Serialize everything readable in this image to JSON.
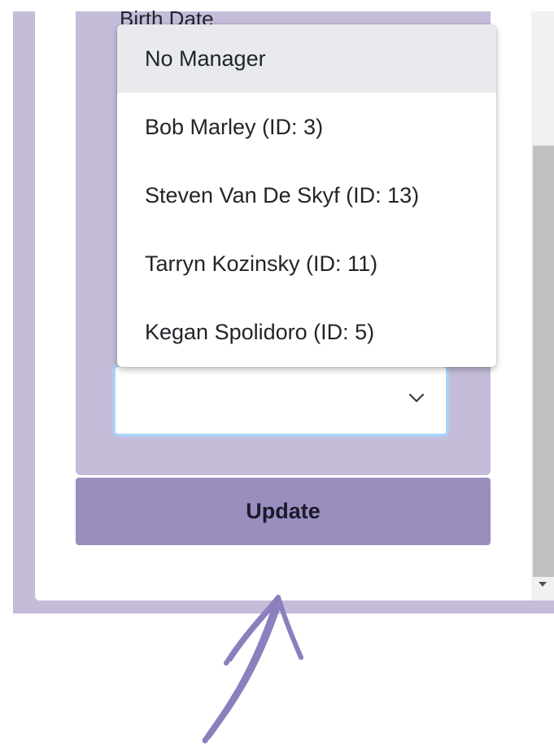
{
  "form": {
    "birth_date_label": "Birth Date",
    "update_label": "Update"
  },
  "manager_select": {
    "selected_value": "",
    "options": [
      {
        "label": "No Manager",
        "highlighted": true
      },
      {
        "label": "Bob Marley (ID: 3)",
        "highlighted": false
      },
      {
        "label": "Steven Van De Skyf (ID: 13)",
        "highlighted": false
      },
      {
        "label": "Tarryn Kozinsky (ID: 11)",
        "highlighted": false
      },
      {
        "label": "Kegan Spolidoro (ID: 5)",
        "highlighted": false
      }
    ]
  },
  "icons": {
    "select_chevron": "chevron-down-icon",
    "scroll_down": "scroll-down-arrow-icon",
    "annotation": "hand-drawn-arrow-icon"
  },
  "colors": {
    "card_background": "#c4bcd9",
    "button_background": "#9a8ebf",
    "focus_border": "#a9d4f7",
    "highlight": "#e8eaed",
    "annotation_arrow": "#8c7fbd"
  }
}
